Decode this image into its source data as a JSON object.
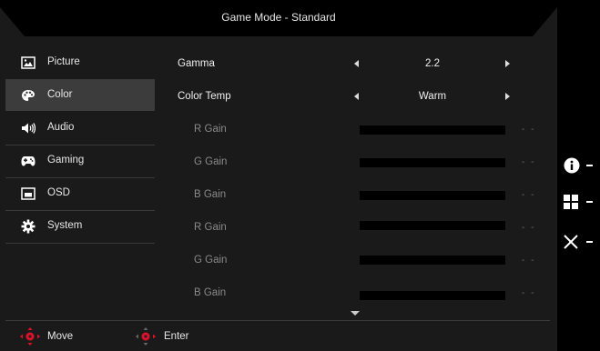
{
  "title": "Game Mode - Standard",
  "menu": [
    {
      "label": "Picture",
      "icon": "picture-icon",
      "active": false
    },
    {
      "label": "Color",
      "icon": "palette-icon",
      "active": true
    },
    {
      "label": "Audio",
      "icon": "speaker-icon",
      "active": false
    },
    {
      "label": "Gaming",
      "icon": "gamepad-icon",
      "active": false
    },
    {
      "label": "OSD",
      "icon": "osd-icon",
      "active": false
    },
    {
      "label": "System",
      "icon": "gear-icon",
      "active": false
    }
  ],
  "settings": {
    "gamma": {
      "label": "Gamma",
      "value": "2.2"
    },
    "color_temp": {
      "label": "Color Temp",
      "value": "Warm"
    },
    "gains": [
      {
        "label": "R Gain",
        "value": "- -"
      },
      {
        "label": "G Gain",
        "value": "- -"
      },
      {
        "label": "B Gain",
        "value": "- -"
      },
      {
        "label": "R Gain",
        "value": "- -"
      },
      {
        "label": "G Gain",
        "value": "- -"
      },
      {
        "label": "B Gain",
        "value": "- -"
      }
    ]
  },
  "hints": {
    "move": "Move",
    "enter": "Enter"
  },
  "side_buttons": [
    "info-icon",
    "grid-icon",
    "close-icon"
  ],
  "colors": {
    "accent": "#e0112a",
    "active_bg": "#3c3c3c",
    "panel_bg": "#1a1a1a"
  }
}
